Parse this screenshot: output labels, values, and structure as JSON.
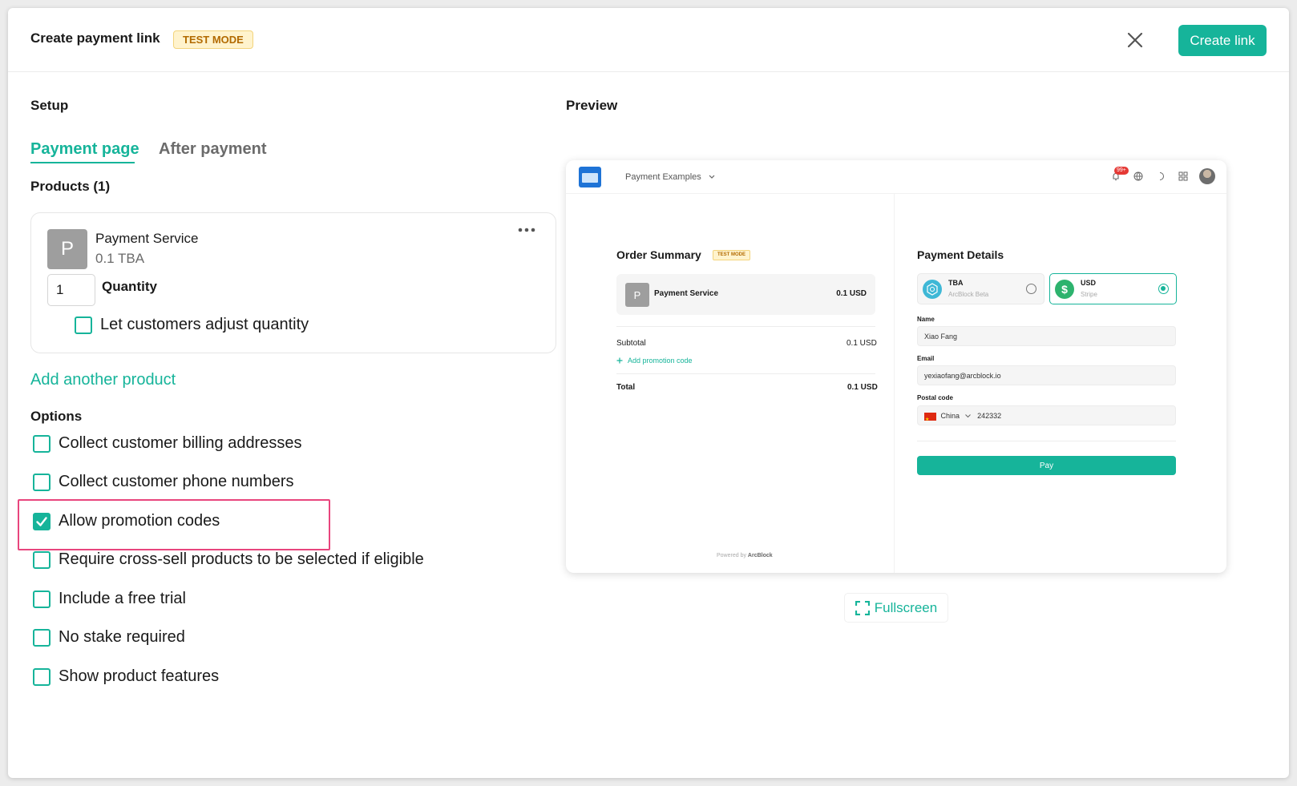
{
  "header": {
    "title": "Create payment link",
    "badge": "TEST MODE",
    "create_label": "Create link"
  },
  "setup": {
    "title": "Setup",
    "tabs": [
      {
        "label": "Payment page",
        "active": true
      },
      {
        "label": "After payment",
        "active": false
      }
    ],
    "products_title": "Products (1)",
    "product": {
      "avatar_letter": "P",
      "name": "Payment Service",
      "price": "0.1 TBA",
      "quantity": "1",
      "quantity_label": "Quantity",
      "adjust_label": "Let customers adjust quantity",
      "adjust_checked": false
    },
    "add_product_label": "Add another product",
    "options_title": "Options",
    "options": [
      {
        "label": "Collect customer billing addresses",
        "checked": false
      },
      {
        "label": "Collect customer phone numbers",
        "checked": false
      },
      {
        "label": "Allow promotion codes",
        "checked": true
      },
      {
        "label": "Require cross-sell products to be selected if eligible",
        "checked": false
      },
      {
        "label": "Include a free trial",
        "checked": false
      },
      {
        "label": "No stake required",
        "checked": false
      },
      {
        "label": "Show product features",
        "checked": false
      }
    ]
  },
  "preview": {
    "title": "Preview",
    "nav_title": "Payment Examples",
    "notification_count": "99+",
    "order_summary": {
      "title": "Order Summary",
      "badge": "TEST MODE",
      "item_letter": "P",
      "item_name": "Payment Service",
      "item_price": "0.1 USD",
      "subtotal_label": "Subtotal",
      "subtotal_value": "0.1 USD",
      "promo_label": "Add promotion code",
      "total_label": "Total",
      "total_value": "0.1 USD"
    },
    "payment_details": {
      "title": "Payment Details",
      "methods": [
        {
          "name": "TBA",
          "sub": "ArcBlock Beta",
          "selected": false
        },
        {
          "name": "USD",
          "sub": "Stripe",
          "selected": true
        }
      ],
      "name_label": "Name",
      "name_value": "Xiao Fang",
      "email_label": "Email",
      "email_value": "yexiaofang@arcblock.io",
      "postal_label": "Postal code",
      "country": "China",
      "postal_value": "242332",
      "pay_label": "Pay"
    },
    "powered_prefix": "Powered by",
    "powered_brand": "ArcBlock"
  },
  "fullscreen_label": "Fullscreen",
  "colors": {
    "accent": "#16b49a",
    "highlight": "#e8457d",
    "badge_bg": "#fff3cd",
    "badge_text": "#b26a00"
  }
}
